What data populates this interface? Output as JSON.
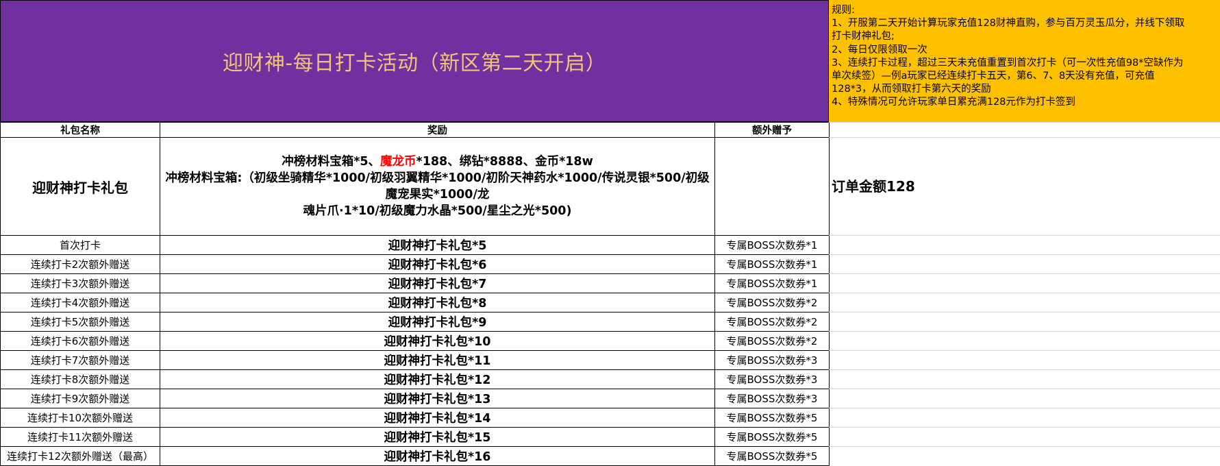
{
  "banner": {
    "title": "迎财神-每日打卡活动（新区第二天开启）"
  },
  "rules": [
    "规则:",
    "1、开服第二天开始计算玩家充值128财神直购，参与百万灵玉瓜分，并线下领取",
    "打卡财神礼包;",
    "2、每日仅限领取一次",
    "3、连续打卡过程，超过三天未充值重置到首次打卡（可一次性充值98*空缺作为",
    "单次续签）—例a玩家已经连续打卡五天，第6、7、8天没有充值，可充值",
    "128*3，从而领取打卡第六天的奖励",
    "4、特殊情况可允许玩家单日累充满128元作为打卡签到"
  ],
  "table": {
    "headers": [
      "礼包名称",
      "奖励",
      "额外赠予"
    ],
    "pack": {
      "name": "迎财神打卡礼包",
      "reward_line1_a": "冲榜材料宝箱*5、",
      "reward_line1_red": "魔龙币",
      "reward_line1_b": "*188、绑钻*8888、金币*18w",
      "reward_line2": "冲榜材料宝箱:（初级坐骑精华*1000/初级羽翼精华*1000/初阶天神药水*1000/传说灵银*500/初级魔宠果实*1000/龙",
      "reward_line3": "魂片爪·1*10/初级魔力水晶*500/星尘之光*500)",
      "extra": "",
      "order_amount": "订单金额128"
    },
    "rows": [
      {
        "name": "首次打卡",
        "reward": "迎财神打卡礼包*5",
        "extra": "专属BOSS次数券*1"
      },
      {
        "name": "连续打卡2次额外赠送",
        "reward": "迎财神打卡礼包*6",
        "extra": "专属BOSS次数券*1"
      },
      {
        "name": "连续打卡3次额外赠送",
        "reward": "迎财神打卡礼包*7",
        "extra": "专属BOSS次数券*1"
      },
      {
        "name": "连续打卡4次额外赠送",
        "reward": "迎财神打卡礼包*8",
        "extra": "专属BOSS次数券*2"
      },
      {
        "name": "连续打卡5次额外赠送",
        "reward": "迎财神打卡礼包*9",
        "extra": "专属BOSS次数券*2"
      },
      {
        "name": "连续打卡6次额外赠送",
        "reward": "迎财神打卡礼包*10",
        "extra": "专属BOSS次数券*2"
      },
      {
        "name": "连续打卡7次额外赠送",
        "reward": "迎财神打卡礼包*11",
        "extra": "专属BOSS次数券*3"
      },
      {
        "name": "连续打卡8次额外赠送",
        "reward": "迎财神打卡礼包*12",
        "extra": "专属BOSS次数券*3"
      },
      {
        "name": "连续打卡9次额外赠送",
        "reward": "迎财神打卡礼包*13",
        "extra": "专属BOSS次数券*3"
      },
      {
        "name": "连续打卡10次额外赠送",
        "reward": "迎财神打卡礼包*14",
        "extra": "专属BOSS次数券*5"
      },
      {
        "name": "连续打卡11次额外赠送",
        "reward": "迎财神打卡礼包*15",
        "extra": "专属BOSS次数券*5"
      },
      {
        "name": "连续打卡12次额外赠送（最高）",
        "reward": "迎财神打卡礼包*16",
        "extra": "专属BOSS次数券*5"
      }
    ]
  },
  "colors": {
    "banner_bg": "#7030a0",
    "banner_text": "#f2c478",
    "rules_bg": "#ffc000",
    "highlight_red": "#ff0000"
  }
}
